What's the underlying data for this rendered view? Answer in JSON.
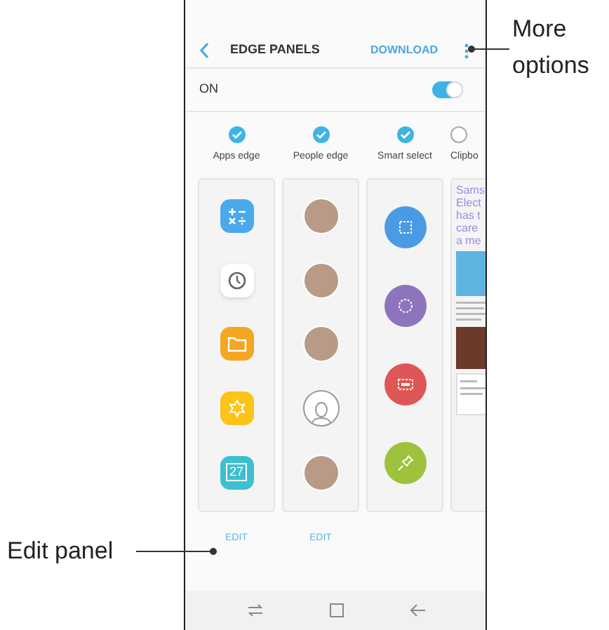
{
  "header": {
    "title": "EDGE PANELS",
    "action": "DOWNLOAD"
  },
  "master_switch": {
    "label": "ON",
    "on": true
  },
  "panels": [
    {
      "kind": "apps",
      "label": "Apps edge",
      "checked": true,
      "edit": "EDIT",
      "items": [
        {
          "kind": "calculator",
          "color": "#4aa8ec"
        },
        {
          "kind": "clock",
          "color": "#ffffff"
        },
        {
          "kind": "folder",
          "color": "#f5a623"
        },
        {
          "kind": "flower",
          "color": "#fcc419"
        },
        {
          "kind": "calendar",
          "color": "#3cbfd0",
          "text": "27"
        }
      ]
    },
    {
      "kind": "people",
      "label": "People edge",
      "checked": true,
      "edit": "EDIT",
      "items": [
        {
          "kind": "photo"
        },
        {
          "kind": "photo"
        },
        {
          "kind": "photo"
        },
        {
          "kind": "silhouette"
        },
        {
          "kind": "photo"
        }
      ]
    },
    {
      "kind": "smart",
      "label": "Smart select",
      "checked": true,
      "items": [
        {
          "kind": "rectangle",
          "color": "#4a9be3"
        },
        {
          "kind": "oval",
          "color": "#8e73bd"
        },
        {
          "kind": "gif",
          "color": "#de5656"
        },
        {
          "kind": "pin",
          "color": "#9ec23e"
        }
      ]
    },
    {
      "kind": "clipboard",
      "label": "Clipbo",
      "checked": false,
      "lines": [
        "Sams",
        "Elect",
        "has t",
        "care",
        "a me"
      ]
    }
  ],
  "callouts": [
    {
      "text": "More options"
    },
    {
      "text": "Edit panel"
    }
  ]
}
